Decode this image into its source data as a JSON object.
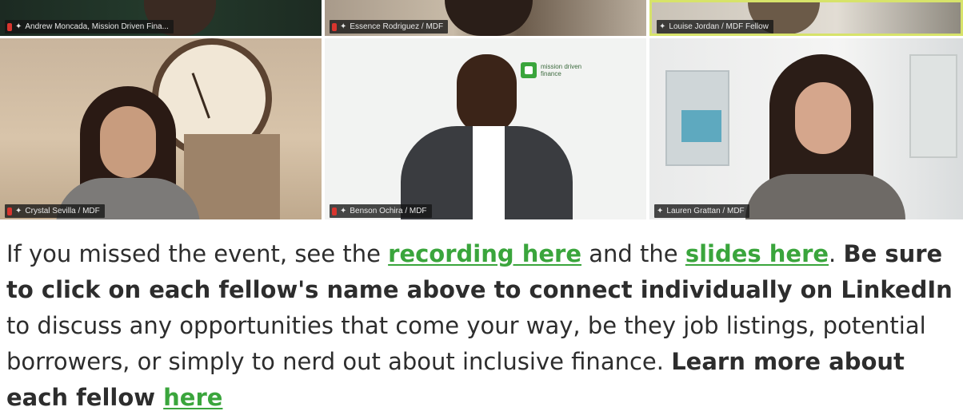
{
  "participants_top": [
    {
      "name": "Andrew Moncada, Mission Driven Fina...",
      "muted": true
    },
    {
      "name": "Essence Rodriguez / MDF",
      "muted": true
    },
    {
      "name": "Louise Jordan / MDF Fellow",
      "muted": false
    }
  ],
  "participants_bottom": [
    {
      "name": "Crystal Sevilla / MDF",
      "muted": true
    },
    {
      "name": "Benson Ochira / MDF",
      "muted": true
    },
    {
      "name": "Lauren Grattan / MDF",
      "muted": false
    }
  ],
  "logo": {
    "line1": "mission driven",
    "line2": "finance"
  },
  "article": {
    "t1": "If you missed the event, see the ",
    "link_recording": "recording here",
    "t2": " and the ",
    "link_slides": "slides here",
    "t3": ". ",
    "bold1": "Be sure to click on each fellow's name above to connect individually on LinkedIn",
    "t4": " to discuss any opportunities that come your way, be they job listings, potential borrowers, or simply to nerd out about inclusive finance. ",
    "bold2": "Learn more about each fellow ",
    "link_partial": "here"
  },
  "colors": {
    "link": "#3aa53c",
    "mute": "#d8352e",
    "highlight": "#d7e36a"
  }
}
